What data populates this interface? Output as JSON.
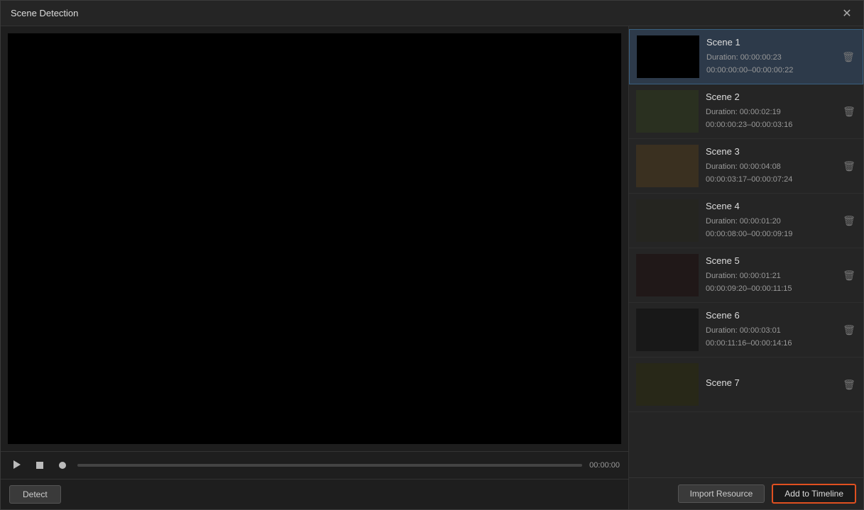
{
  "window": {
    "title": "Scene Detection"
  },
  "controls": {
    "play_label": "▶",
    "stop_label": "■",
    "record_label": "●",
    "time": "00:00:00",
    "detect_label": "Detect"
  },
  "bottom": {
    "import_label": "Import Resource",
    "add_timeline_label": "Add to Timeline"
  },
  "scenes": [
    {
      "id": 1,
      "title": "Scene 1",
      "duration": "Duration: 00:00:00:23",
      "range": "00:00:00:00–00:00:00:22",
      "thumb_class": "thumb-s1",
      "active": true
    },
    {
      "id": 2,
      "title": "Scene 2",
      "duration": "Duration: 00:00:02:19",
      "range": "00:00:00:23–00:00:03:16",
      "thumb_class": "thumb-s2",
      "active": false
    },
    {
      "id": 3,
      "title": "Scene 3",
      "duration": "Duration: 00:00:04:08",
      "range": "00:00:03:17–00:00:07:24",
      "thumb_class": "thumb-s3",
      "active": false
    },
    {
      "id": 4,
      "title": "Scene 4",
      "duration": "Duration: 00:00:01:20",
      "range": "00:00:08:00–00:00:09:19",
      "thumb_class": "thumb-s4",
      "active": false
    },
    {
      "id": 5,
      "title": "Scene 5",
      "duration": "Duration: 00:00:01:21",
      "range": "00:00:09:20–00:00:11:15",
      "thumb_class": "thumb-s5",
      "active": false
    },
    {
      "id": 6,
      "title": "Scene 6",
      "duration": "Duration: 00:00:03:01",
      "range": "00:00:11:16–00:00:14:16",
      "thumb_class": "thumb-s6",
      "active": false
    },
    {
      "id": 7,
      "title": "Scene 7",
      "duration": "",
      "range": "",
      "thumb_class": "thumb-s7",
      "active": false
    }
  ]
}
